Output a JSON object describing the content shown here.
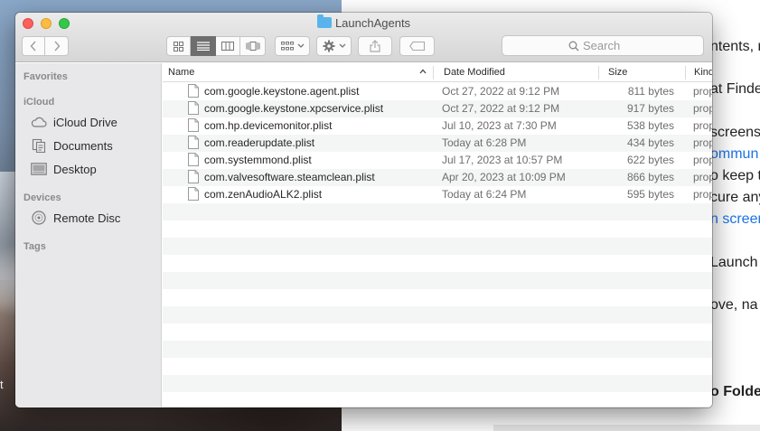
{
  "window": {
    "title": "LaunchAgents"
  },
  "toolbar": {
    "back_icon": "chevron-left-icon",
    "forward_icon": "chevron-right-icon",
    "views": [
      "icon-view",
      "list-view",
      "column-view",
      "cover-flow-view"
    ],
    "active_view": "list-view",
    "search_placeholder": "Search"
  },
  "sidebar": {
    "sections": [
      {
        "header": "Favorites",
        "items": []
      },
      {
        "header": "iCloud",
        "items": [
          {
            "label": "iCloud Drive",
            "icon": "cloud-icon"
          },
          {
            "label": "Documents",
            "icon": "documents-icon"
          },
          {
            "label": "Desktop",
            "icon": "desktop-icon"
          }
        ]
      },
      {
        "header": "Devices",
        "items": [
          {
            "label": "Remote Disc",
            "icon": "disc-icon"
          }
        ]
      },
      {
        "header": "Tags",
        "items": []
      }
    ]
  },
  "columns": {
    "name": "Name",
    "date": "Date Modified",
    "size": "Size",
    "kind": "Kind"
  },
  "files": [
    {
      "name": "com.google.keystone.agent.plist",
      "date": "Oct 27, 2022 at 9:12 PM",
      "size": "811 bytes",
      "kind": "prop"
    },
    {
      "name": "com.google.keystone.xpcservice.plist",
      "date": "Oct 27, 2022 at 9:12 PM",
      "size": "917 bytes",
      "kind": "prop"
    },
    {
      "name": "com.hp.devicemonitor.plist",
      "date": "Jul 10, 2023 at 7:30 PM",
      "size": "538 bytes",
      "kind": "prop"
    },
    {
      "name": "com.readerupdate.plist",
      "date": "Today at 6:28 PM",
      "size": "434 bytes",
      "kind": "prop"
    },
    {
      "name": "com.systemmond.plist",
      "date": "Jul 17, 2023 at 10:57 PM",
      "size": "622 bytes",
      "kind": "prop"
    },
    {
      "name": "com.valvesoftware.steamclean.plist",
      "date": "Apr 20, 2023 at 10:09 PM",
      "size": "866 bytes",
      "kind": "prop"
    },
    {
      "name": "com.zenAudioALK2.plist",
      "date": "Today at 6:24 PM",
      "size": "595 bytes",
      "kind": "prop"
    }
  ],
  "webpage_fragments": [
    {
      "text": "ntents, r",
      "style": "normal"
    },
    {
      "text": "at Finde",
      "style": "normal"
    },
    {
      "text": "screens",
      "style": "normal"
    },
    {
      "text": "ommun",
      "style": "link"
    },
    {
      "text": "o keep t",
      "style": "normal"
    },
    {
      "text": "cure any",
      "style": "normal"
    },
    {
      "text": "n screen",
      "style": "link"
    },
    {
      "text": "Launch",
      "style": "normal"
    },
    {
      "text": "ove, na",
      "style": "normal"
    },
    {
      "text": "o Folde",
      "style": "bold"
    }
  ],
  "desktop_text": "t",
  "colors": {
    "close": "#fc605b",
    "minimize": "#fdbc40",
    "maximize": "#34c84a",
    "folder": "#59b4ec",
    "sidebar_bg": "#e8e8ea",
    "link": "#1a73e8"
  }
}
